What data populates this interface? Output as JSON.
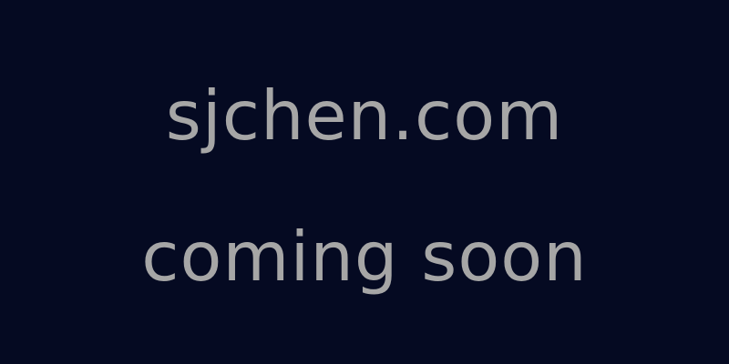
{
  "page": {
    "domain": "sjchen.com",
    "status": "coming soon",
    "background_color": "#050a22",
    "text_color": "#a6a6a6"
  }
}
